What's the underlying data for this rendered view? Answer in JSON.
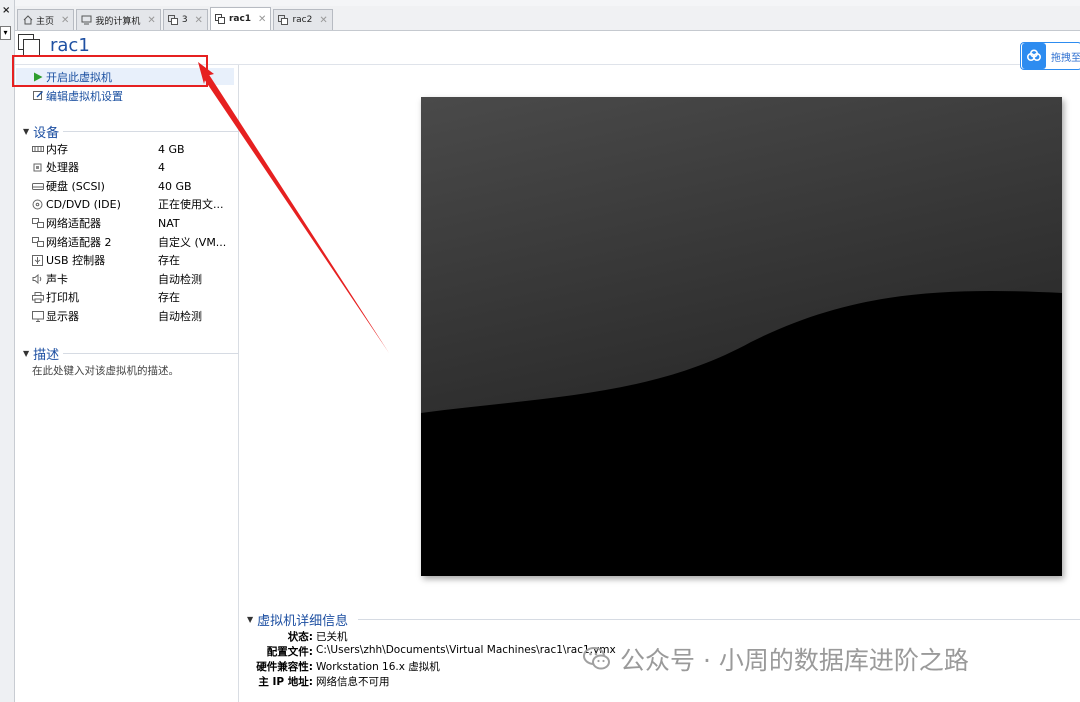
{
  "tabs": [
    {
      "label": "主页",
      "icon": "home-icon",
      "active": false
    },
    {
      "label": "我的计算机",
      "icon": "computer-icon",
      "active": false
    },
    {
      "label": "3",
      "icon": "vm-group-icon",
      "active": false
    },
    {
      "label": "rac1",
      "icon": "vm-icon",
      "active": true
    },
    {
      "label": "rac2",
      "icon": "vm-icon",
      "active": false
    }
  ],
  "vm": {
    "title": "rac1"
  },
  "badge": {
    "label": "拖拽至"
  },
  "actions": {
    "power_on": "开启此虚拟机",
    "edit_settings": "编辑虚拟机设置"
  },
  "devices": {
    "heading": "设备",
    "items": [
      {
        "name": "内存",
        "value": "4 GB",
        "icon": "memory-icon"
      },
      {
        "name": "处理器",
        "value": "4",
        "icon": "cpu-icon"
      },
      {
        "name": "硬盘 (SCSI)",
        "value": "40 GB",
        "icon": "hard-disk-icon"
      },
      {
        "name": "CD/DVD (IDE)",
        "value": "正在使用文...",
        "icon": "cd-dvd-icon"
      },
      {
        "name": "网络适配器",
        "value": "NAT",
        "icon": "network-adapter-icon"
      },
      {
        "name": "网络适配器 2",
        "value": "自定义 (VM...",
        "icon": "network-adapter-icon"
      },
      {
        "name": "USB 控制器",
        "value": "存在",
        "icon": "usb-icon"
      },
      {
        "name": "声卡",
        "value": "自动检测",
        "icon": "sound-icon"
      },
      {
        "name": "打印机",
        "value": "存在",
        "icon": "printer-icon"
      },
      {
        "name": "显示器",
        "value": "自动检测",
        "icon": "display-icon"
      }
    ]
  },
  "description": {
    "heading": "描述",
    "placeholder": "在此处键入对该虚拟机的描述。"
  },
  "details": {
    "heading": "虚拟机详细信息",
    "rows": [
      {
        "key": "状态:",
        "value": "已关机"
      },
      {
        "key": "配置文件:",
        "value": "C:\\Users\\zhh\\Documents\\Virtual Machines\\rac1\\rac1.vmx"
      },
      {
        "key": "硬件兼容性:",
        "value": "Workstation 16.x 虚拟机"
      },
      {
        "key": "主 IP 地址:",
        "value": "网络信息不可用"
      }
    ]
  },
  "watermark": {
    "text": "公众号 · 小周的数据库进阶之路"
  },
  "colors": {
    "accent": "#1e50a2",
    "annotation": "#e62020",
    "play": "#2e9e2e"
  }
}
